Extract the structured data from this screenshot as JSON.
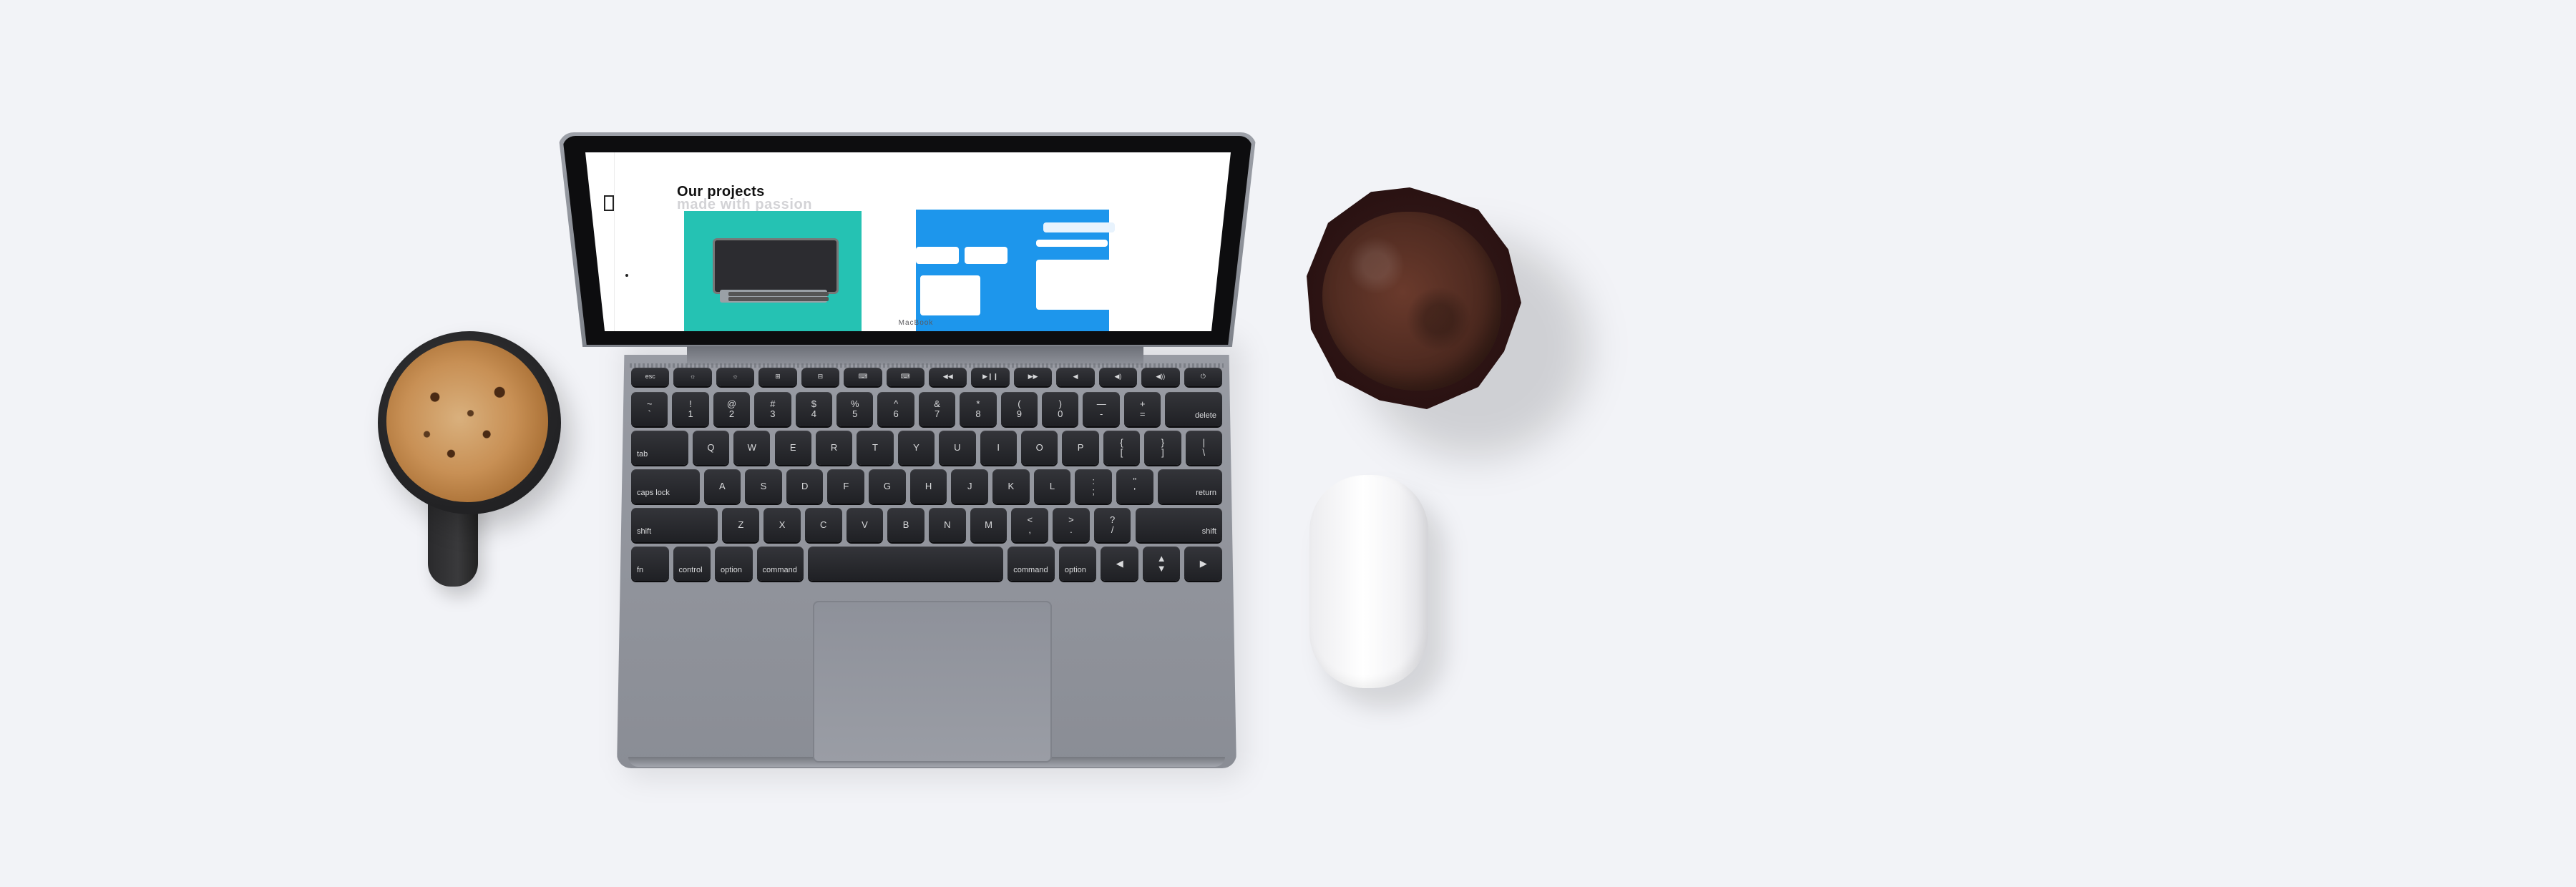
{
  "scene": {
    "laptop": {
      "brand_text": "MacBook",
      "screen": {
        "title": "Our projects",
        "subtitle": "made with passion"
      },
      "keyboard": {
        "function_row": [
          "esc",
          "☼",
          "☼",
          "⊞",
          "⊟",
          "⌨",
          "⌨",
          "◀◀",
          "▶❙❙",
          "▶▶",
          "◀",
          "◀)",
          "◀))",
          "⏻"
        ],
        "number_row": [
          "~\n`",
          "!\n1",
          "@\n2",
          "#\n3",
          "$\n4",
          "%\n5",
          "^\n6",
          "&\n7",
          "*\n8",
          "(\n9",
          ")\n0",
          "—\n-",
          "+\n=",
          "delete"
        ],
        "top_row": [
          "tab",
          "Q",
          "W",
          "E",
          "R",
          "T",
          "Y",
          "U",
          "I",
          "O",
          "P",
          "{\n[",
          "}\n]",
          "|\n\\"
        ],
        "home_row": [
          "caps lock",
          "A",
          "S",
          "D",
          "F",
          "G",
          "H",
          "J",
          "K",
          "L",
          ":\n;",
          "\"\n'",
          "return"
        ],
        "bottom_row": [
          "shift",
          "Z",
          "X",
          "C",
          "V",
          "B",
          "N",
          "M",
          "<\n,",
          ">\n.",
          "?\n/",
          "shift"
        ],
        "modifier_row": [
          "fn",
          "control",
          "option",
          "command",
          "",
          "command",
          "option",
          "◀",
          "▲\n▼",
          "▶"
        ]
      }
    },
    "coffee_mug": {},
    "muffin": {},
    "mouse": {}
  },
  "colors": {
    "background": "#f2f3f7",
    "card_teal": "#25c2b3",
    "card_blue": "#1d96ec",
    "laptop_silver": "#8f929a"
  }
}
